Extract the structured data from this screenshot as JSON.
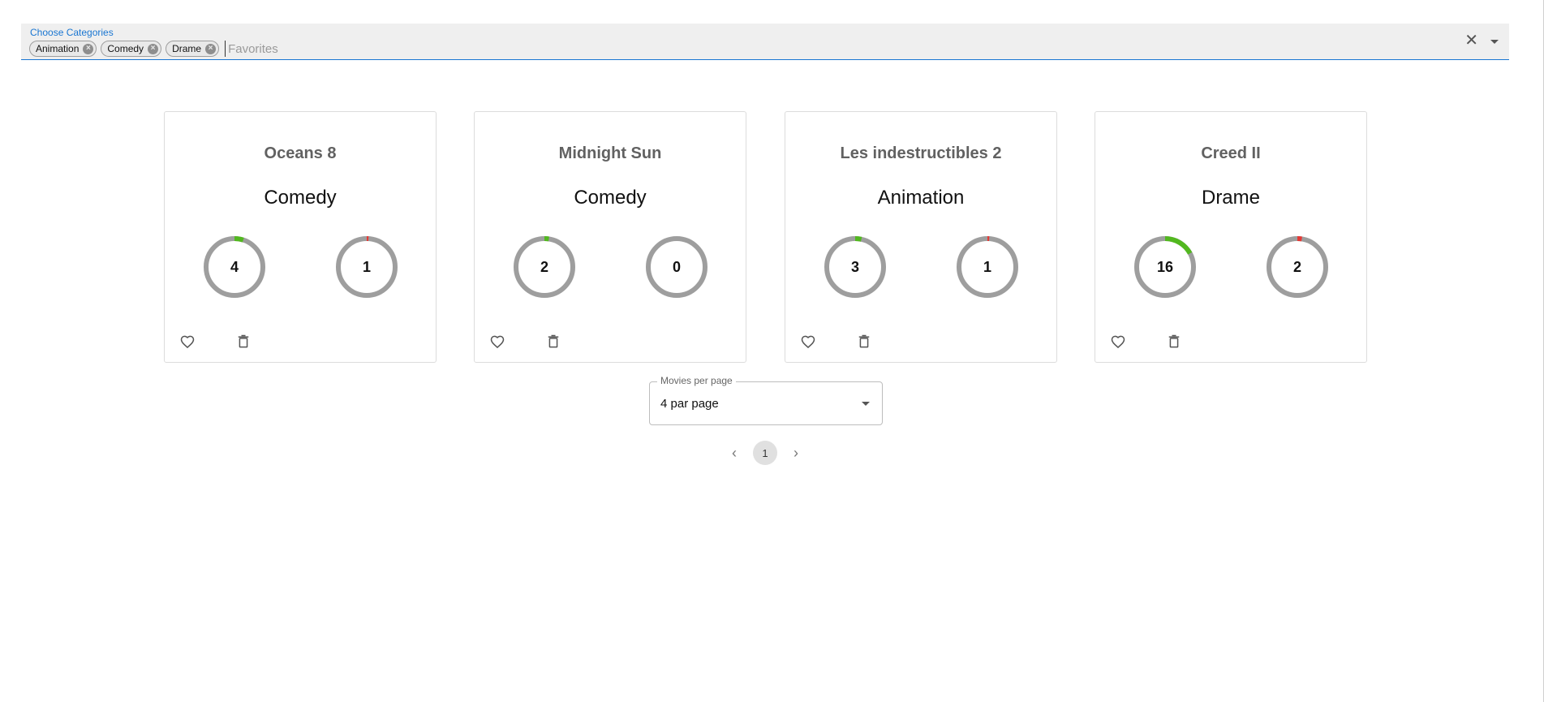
{
  "filter": {
    "label": "Choose Categories",
    "chips": [
      "Animation",
      "Comedy",
      "Drame"
    ],
    "placeholder": "Favorites",
    "clear_icon": "close-icon",
    "dropdown_icon": "arrow-drop-down-icon"
  },
  "cards": [
    {
      "title": "Oceans 8",
      "category": "Comedy",
      "likes": "4",
      "dislikes": "1",
      "likes_fraction": 0.05,
      "dislikes_fraction": 0.01
    },
    {
      "title": "Midnight Sun",
      "category": "Comedy",
      "likes": "2",
      "dislikes": "0",
      "likes_fraction": 0.025,
      "dislikes_fraction": 0
    },
    {
      "title": "Les indestructibles 2",
      "category": "Animation",
      "likes": "3",
      "dislikes": "1",
      "likes_fraction": 0.035,
      "dislikes_fraction": 0.01
    },
    {
      "title": "Creed II",
      "category": "Drame",
      "likes": "16",
      "dislikes": "2",
      "likes_fraction": 0.17,
      "dislikes_fraction": 0.025
    }
  ],
  "actions": {
    "like_icon": "heart-outline-icon",
    "delete_icon": "trash-icon"
  },
  "per_page": {
    "label": "Movies per page",
    "value": "4 par page"
  },
  "pagination": {
    "current": "1",
    "prev_icon": "chevron-left-icon",
    "next_icon": "chevron-right-icon"
  },
  "colors": {
    "accent": "#1976d2",
    "ring_track": "#9e9e9e",
    "like": "#52b81f",
    "dislike": "#e53935"
  }
}
